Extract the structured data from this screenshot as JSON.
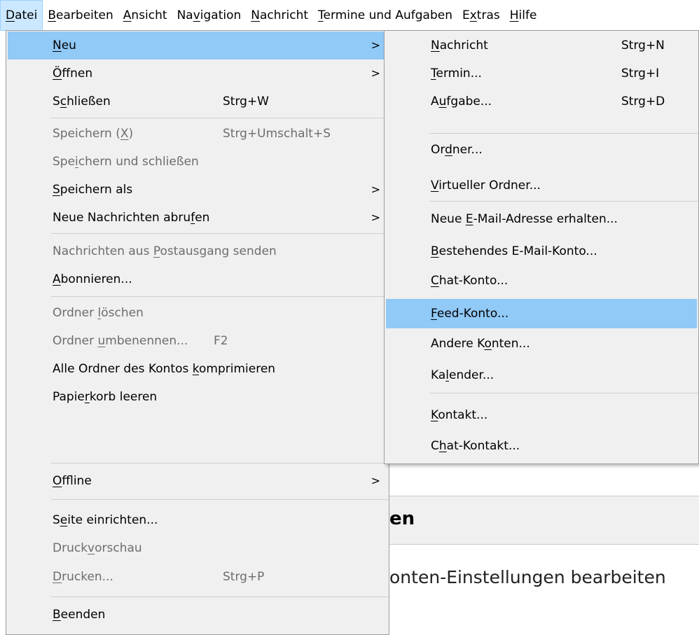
{
  "menubar": [
    {
      "label": "Datei",
      "ul": "D",
      "rest": "atei",
      "active": true
    },
    {
      "label": "Bearbeiten",
      "ul": "B",
      "rest": "earbeiten"
    },
    {
      "label": "Ansicht",
      "ul": "A",
      "rest": "nsicht"
    },
    {
      "label": "Navigation",
      "pre": "Na",
      "ul": "v",
      "rest": "igation"
    },
    {
      "label": "Nachricht",
      "ul": "N",
      "rest": "achricht"
    },
    {
      "label": "Termine und Aufgaben",
      "ul": "T",
      "rest": "ermine und Aufgaben"
    },
    {
      "label": "Extras",
      "pre": "E",
      "ul": "x",
      "rest": "tras"
    },
    {
      "label": "Hilfe",
      "ul": "H",
      "rest": "ilfe"
    }
  ],
  "datei_menu": {
    "neu": {
      "ul": "N",
      "rest": "eu"
    },
    "oeffnen": {
      "ul": "Ö",
      "rest": "ffnen"
    },
    "schliessen": {
      "pre": "S",
      "ul": "c",
      "rest": "hließen",
      "shortcut": "Strg+W"
    },
    "speichern": {
      "pre": "Speichern (",
      "ul": "X",
      "rest": ")",
      "shortcut": "Strg+Umschalt+S"
    },
    "speichern_schliessen": {
      "pre": "Spe",
      "ul": "i",
      "rest": "chern und schließen"
    },
    "speichern_als": {
      "ul": "S",
      "rest": "peichern als"
    },
    "abrufen": {
      "pre": "Neue Nachrichten abru",
      "ul": "f",
      "rest": "en"
    },
    "postausgang": {
      "pre": "Nachrichten aus ",
      "ul": "P",
      "rest": "ostausgang senden"
    },
    "abonnieren": {
      "ul": "A",
      "rest": "bonnieren..."
    },
    "ordner_loeschen": {
      "pre": "Ordner ",
      "ul": "l",
      "rest": "öschen"
    },
    "ordner_umbenennen": {
      "pre": "Ordner ",
      "ul": "u",
      "rest": "mbenennen...",
      "shortcut": "F2"
    },
    "komprimieren": {
      "pre": "Alle Ordner des Kontos ",
      "ul": "k",
      "rest": "omprimieren"
    },
    "papierkorb": {
      "pre": "Papie",
      "ul": "r",
      "rest": "korb leeren"
    },
    "offline": {
      "ul": "O",
      "rest": "ffline"
    },
    "seite": {
      "pre": "S",
      "ul": "e",
      "rest": "ite einrichten..."
    },
    "druckvorschau": {
      "pre": "Druck",
      "ul": "v",
      "rest": "orschau"
    },
    "drucken": {
      "ul": "D",
      "rest": "rucken...",
      "shortcut": "Strg+P"
    },
    "beenden": {
      "ul": "B",
      "rest": "eenden"
    },
    "arrow": ">"
  },
  "neu_menu": {
    "nachricht": {
      "ul": "N",
      "rest": "achricht",
      "shortcut": "Strg+N"
    },
    "termin": {
      "ul": "T",
      "rest": "ermin...",
      "shortcut": "Strg+I"
    },
    "aufgabe": {
      "pre": "A",
      "ul": "u",
      "rest": "fgabe...",
      "shortcut": "Strg+D"
    },
    "ordner": {
      "pre": "Or",
      "ul": "d",
      "rest": "ner..."
    },
    "virtueller": {
      "ul": "V",
      "rest": "irtueller Ordner..."
    },
    "email_adresse": {
      "pre": "Neue ",
      "ul": "E",
      "rest": "-Mail-Adresse erhalten..."
    },
    "bestehendes": {
      "ul": "B",
      "rest": "estehendes E-Mail-Konto..."
    },
    "chat_konto": {
      "ul": "C",
      "rest": "hat-Konto..."
    },
    "feed_konto": {
      "ul": "F",
      "rest": "eed-Konto..."
    },
    "andere": {
      "pre": "Andere K",
      "ul": "o",
      "rest": "nten..."
    },
    "kalender": {
      "pre": "Ka",
      "ul": "l",
      "rest": "ender..."
    },
    "kontakt": {
      "ul": "K",
      "rest": "ontakt..."
    },
    "chat_kontakt": {
      "pre": "C",
      "ul": "h",
      "rest": "at-Kontakt..."
    }
  },
  "background": {
    "heading": "en",
    "subtext": "onten-Einstellungen bearbeiten"
  }
}
